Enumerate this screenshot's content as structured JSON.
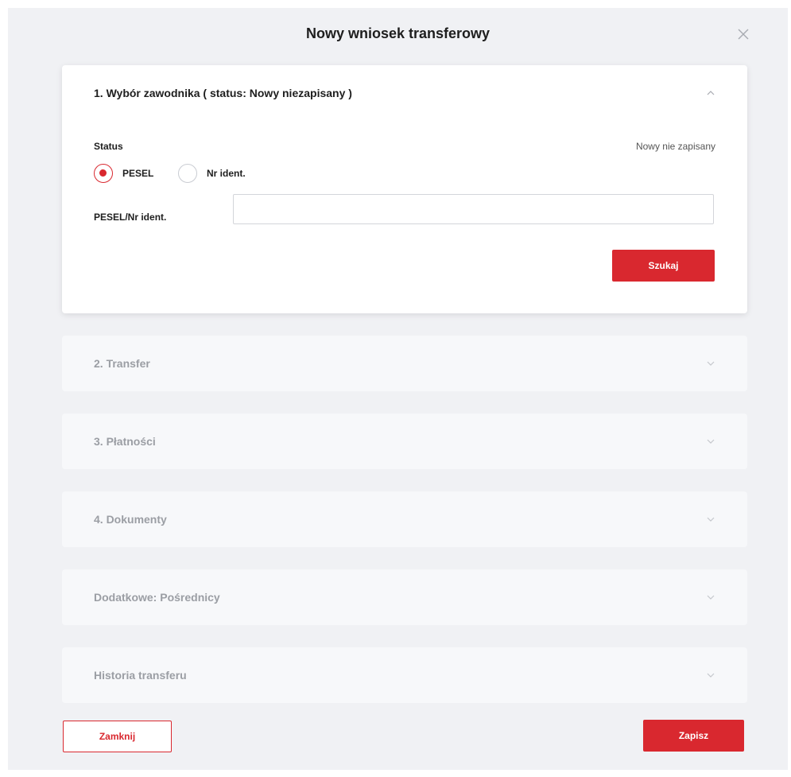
{
  "modal": {
    "title": "Nowy wniosek transferowy",
    "close_icon": "close-icon"
  },
  "section1": {
    "title": "1. Wybór zawodnika ( status: Nowy niezapisany )",
    "status_label": "Status",
    "status_value": "Nowy nie zapisany",
    "radio_options": [
      {
        "label": "PESEL",
        "checked": true
      },
      {
        "label": "Nr ident.",
        "checked": false
      }
    ],
    "field_label": "PESEL/Nr ident.",
    "field_value": "",
    "search_button": "Szukaj"
  },
  "sections": [
    {
      "title": "2. Transfer"
    },
    {
      "title": "3. Płatności"
    },
    {
      "title": "4. Dokumenty"
    },
    {
      "title": "Dodatkowe: Pośrednicy"
    },
    {
      "title": "Historia transferu"
    }
  ],
  "footer": {
    "close_button": "Zamknij",
    "save_button": "Zapisz"
  },
  "colors": {
    "accent": "#d9282f",
    "panel_bg": "#f0f1f4",
    "collapsed_card": "#f7f8fa"
  }
}
